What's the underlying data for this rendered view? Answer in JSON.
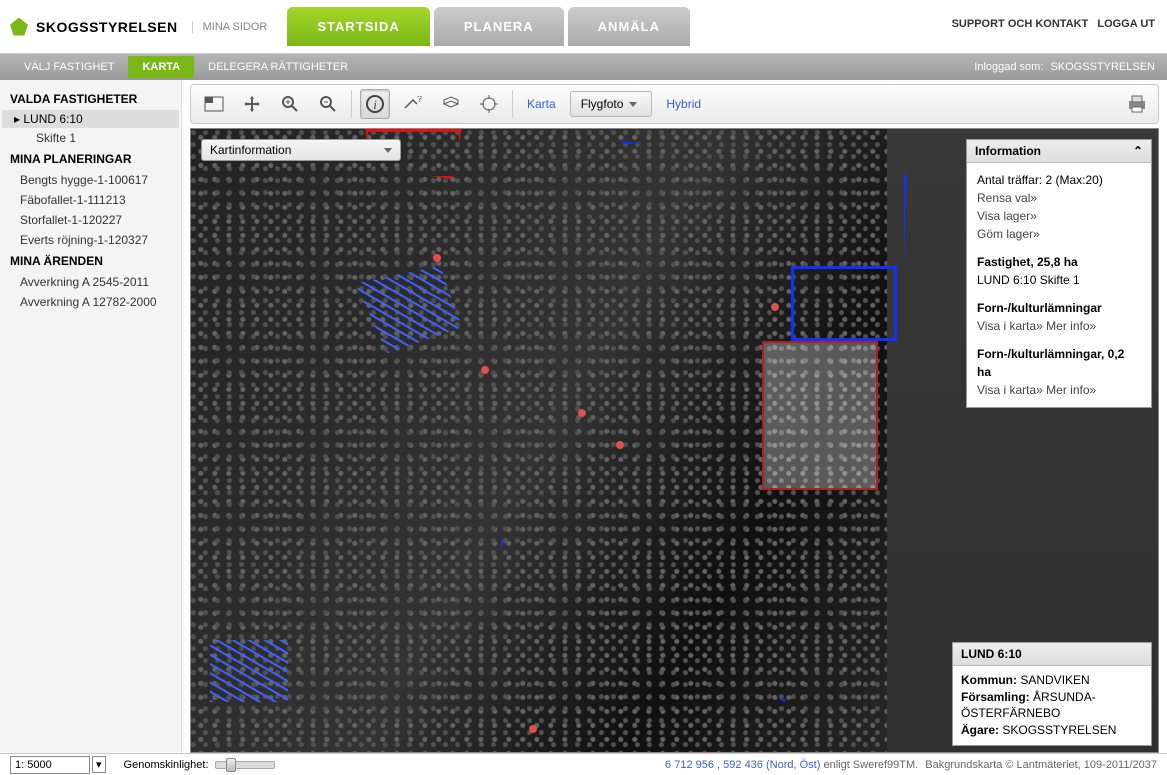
{
  "brand": {
    "name": "SKOGSSTYRELSEN",
    "section": "MINA SIDOR"
  },
  "top_right": {
    "support": "SUPPORT OCH KONTAKT",
    "logout": "LOGGA UT"
  },
  "main_tabs": {
    "start": "STARTSIDA",
    "planera": "PLANERA",
    "anmala": "ANMÄLA"
  },
  "sub_tabs": {
    "valj": "VÄLJ FASTIGHET",
    "karta": "KARTA",
    "delegera": "DELEGERA RÄTTIGHETER"
  },
  "login_status": {
    "prefix": "Inloggad som:",
    "user": "SKOGSSTYRELSEN"
  },
  "sidebar": {
    "heading1": "VALDA FASTIGHETER",
    "prop_active": "LUND 6:10",
    "prop_sub": "Skifte 1",
    "heading2": "MINA PLANERINGAR",
    "plans": [
      "Bengts hygge-1-100617",
      "Fäbofallet-1-111213",
      "Storfallet-1-120227",
      "Everts röjning-1-120327"
    ],
    "heading3": "MINA ÄRENDEN",
    "cases": [
      "Avverkning A 2545-2011",
      "Avverkning A 12782-2000"
    ]
  },
  "toolbar": {
    "kartinfo": "Kartinformation",
    "view_karta": "Karta",
    "view_flygfoto": "Flygfoto",
    "view_hybrid": "Hybrid"
  },
  "info_panel": {
    "title": "Information",
    "hits": "Antal träffar: 2 (Max:20)",
    "rensa": "Rensa val»",
    "visa": "Visa lager»",
    "gom": "Göm lager»",
    "sec1_title": "Fastighet, 25,8 ha",
    "sec1_sub": "LUND 6:10 Skifte 1",
    "sec2_title": "Forn-/kulturlämningar",
    "sec2_links": "Visa i karta» Mer info»",
    "sec3_title": "Forn-/kulturlämningar, 0,2 ha",
    "sec3_links": "Visa i karta» Mer info»"
  },
  "prop_panel": {
    "title": "LUND 6:10",
    "kommun_lbl": "Kommun:",
    "kommun": "SANDVIKEN",
    "forsamling_lbl": "Församling:",
    "forsamling": "ÅRSUNDA-ÖSTERFÄRNEBO",
    "agare_lbl": "Ägare:",
    "agare": "SKOGSSTYRELSEN"
  },
  "bottom": {
    "scale": "1: 5000",
    "opacity_lbl": "Genomskinlighet:",
    "coords_n": "6 712 956",
    "coords_e": "592 436",
    "coords_dir": "(Nord, Öst)",
    "proj": "enligt Sweref99TM.",
    "credit": "Bakgrundskarta © Lantmäteriet, 109-2011/2037"
  }
}
